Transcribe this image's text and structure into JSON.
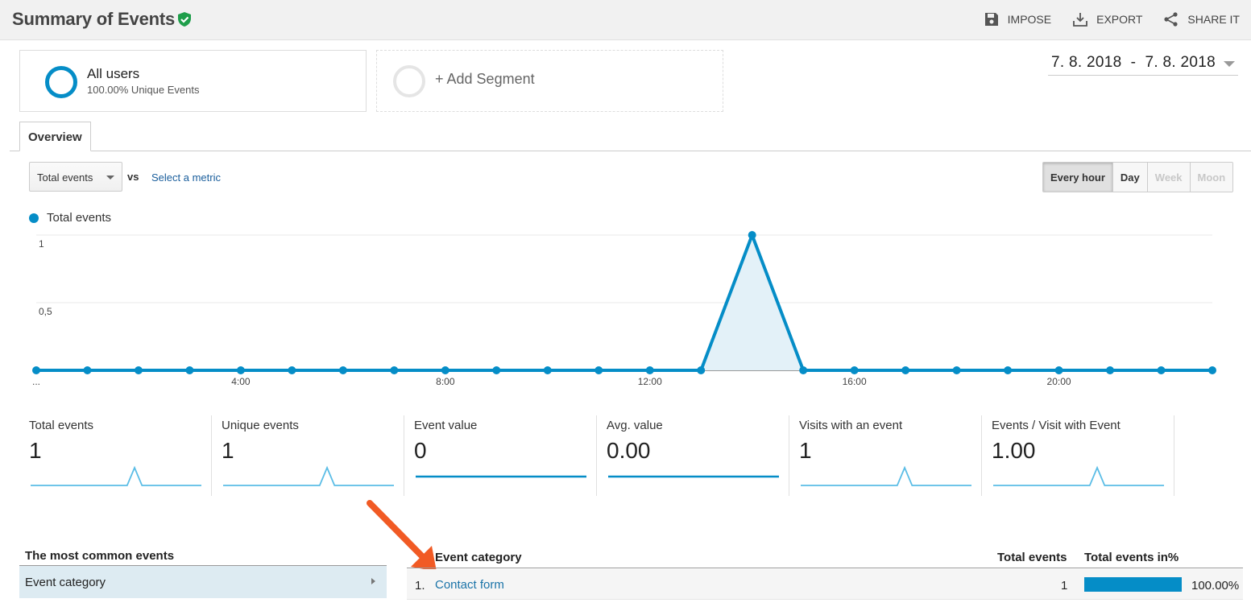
{
  "header": {
    "title": "Summary of Events",
    "actions": [
      {
        "label": "IMPOSE",
        "icon": "save-icon"
      },
      {
        "label": "EXPORT",
        "icon": "download-icon"
      },
      {
        "label": "SHARE IT",
        "icon": "share-icon"
      }
    ]
  },
  "segments": {
    "active": {
      "name": "All users",
      "sub": "100.00% Unique Events"
    },
    "add_label": "+ Add Segment"
  },
  "date_range": "7. 8. 2018  -  7. 8. 2018",
  "tabs": [
    {
      "label": "Overview"
    }
  ],
  "controls": {
    "metric": "Total events",
    "vs": "vs",
    "select_metric": "Select a metric",
    "granularity": [
      {
        "label": "Every hour",
        "state": "active"
      },
      {
        "label": "Day",
        "state": "normal"
      },
      {
        "label": "Week",
        "state": "disabled"
      },
      {
        "label": "Moon",
        "state": "disabled"
      }
    ]
  },
  "chart_data": {
    "type": "area",
    "series": [
      {
        "name": "Total events",
        "color": "#058dc7",
        "values": [
          0,
          0,
          0,
          0,
          0,
          0,
          0,
          0,
          0,
          0,
          0,
          0,
          0,
          0,
          1,
          0,
          0,
          0,
          0,
          0,
          0,
          0,
          0,
          0
        ]
      }
    ],
    "x_labels": [
      "...",
      "",
      "",
      "",
      "4:00",
      "",
      "",
      "",
      "8:00",
      "",
      "",
      "",
      "12:00",
      "",
      "",
      "",
      "16:00",
      "",
      "",
      "",
      "20:00",
      "",
      "",
      ""
    ],
    "y_ticks": [
      "1",
      "0,5"
    ],
    "ylim": [
      0,
      1
    ],
    "grid": true
  },
  "scorecards": [
    {
      "label": "Total events",
      "value": "1",
      "spark": [
        0,
        0,
        0,
        0,
        0,
        0,
        0,
        0,
        0,
        0,
        0,
        0,
        0,
        0,
        1,
        0,
        0,
        0,
        0,
        0,
        0,
        0,
        0,
        0
      ]
    },
    {
      "label": "Unique events",
      "value": "1",
      "spark": [
        0,
        0,
        0,
        0,
        0,
        0,
        0,
        0,
        0,
        0,
        0,
        0,
        0,
        0,
        1,
        0,
        0,
        0,
        0,
        0,
        0,
        0,
        0,
        0
      ]
    },
    {
      "label": "Event value",
      "value": "0",
      "spark": [
        0,
        0,
        0,
        0,
        0,
        0,
        0,
        0,
        0,
        0,
        0,
        0,
        0,
        0,
        0,
        0,
        0,
        0,
        0,
        0,
        0,
        0,
        0,
        0
      ]
    },
    {
      "label": "Avg. value",
      "value": "0.00",
      "spark": [
        0,
        0,
        0,
        0,
        0,
        0,
        0,
        0,
        0,
        0,
        0,
        0,
        0,
        0,
        0,
        0,
        0,
        0,
        0,
        0,
        0,
        0,
        0,
        0
      ]
    },
    {
      "label": "Visits with an event",
      "value": "1",
      "spark": [
        0,
        0,
        0,
        0,
        0,
        0,
        0,
        0,
        0,
        0,
        0,
        0,
        0,
        0,
        1,
        0,
        0,
        0,
        0,
        0,
        0,
        0,
        0,
        0
      ]
    },
    {
      "label": "Events / Visit with Event",
      "value": "1.00",
      "spark": [
        0,
        0,
        0,
        0,
        0,
        0,
        0,
        0,
        0,
        0,
        0,
        0,
        0,
        0,
        1,
        0,
        0,
        0,
        0,
        0,
        0,
        0,
        0,
        0
      ]
    }
  ],
  "common_events": {
    "title": "The most common events",
    "items": [
      {
        "label": "Event category"
      }
    ]
  },
  "table": {
    "headers": {
      "category": "Event category",
      "total": "Total events",
      "pct": "Total events in%"
    },
    "rows": [
      {
        "index": "1.",
        "category": "Contact form",
        "total": "1",
        "pct": "100.00%",
        "share": 1.0
      }
    ]
  },
  "colors": {
    "accent": "#058dc7",
    "arrow": "#f15a24",
    "verified": "#1e9e4a"
  }
}
